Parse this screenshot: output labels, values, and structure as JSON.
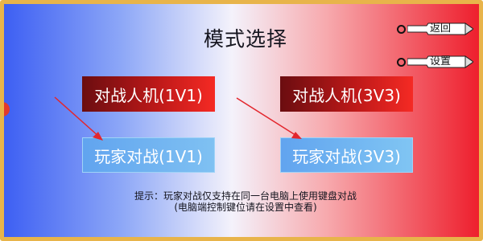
{
  "title": "模式选择",
  "top_buttons": {
    "back": "返回",
    "settings": "设置"
  },
  "modes": {
    "pve_1v1": "对战人机(1V1)",
    "pve_3v3": "对战人机(3V3)",
    "pvp_1v1": "玩家对战(1V1)",
    "pvp_3v3": "玩家对战(3V3)"
  },
  "hint": {
    "line1": "提示：玩家对战仅支持在同一台电脑上使用键盘对战",
    "line2": "(电脑端控制键位请在设置中查看)"
  },
  "colors": {
    "frame": "#e8b44a",
    "ai_button": "#bb1818",
    "player_button": "#6fb3f0",
    "arrow": "#e3262d"
  }
}
